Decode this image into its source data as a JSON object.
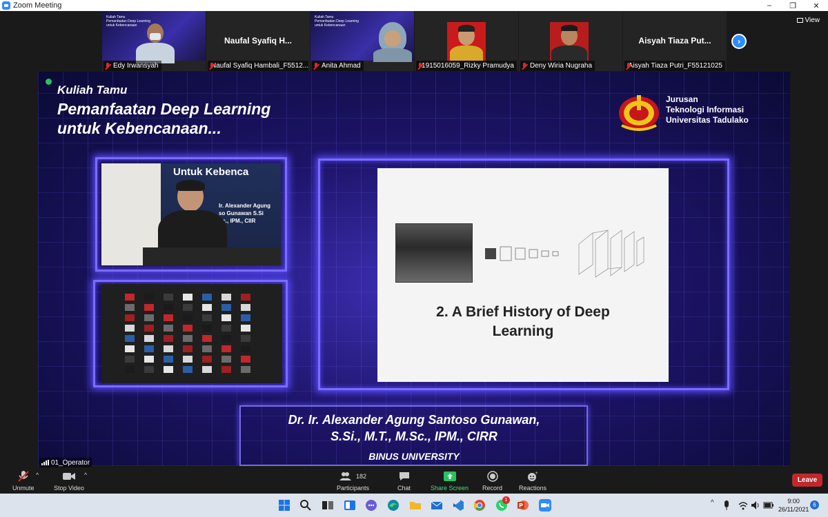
{
  "window": {
    "title": "Zoom Meeting"
  },
  "view": {
    "label": "View"
  },
  "participants_strip": [
    {
      "name": "Edy Irwansyah",
      "type": "video"
    },
    {
      "name": "Naufal Syafiq Hambali_F5512...",
      "center": "Naufal Syafiq H...",
      "type": "name"
    },
    {
      "name": "Anita Ahmad",
      "type": "video"
    },
    {
      "name": "1915016059_Rizky Pramudya",
      "type": "photo"
    },
    {
      "name": "Deny Wiria Nugraha",
      "type": "photo"
    },
    {
      "name": "Aisyah Tiaza Putri_F55121025",
      "center": "Aisyah Tiaza Put...",
      "type": "name"
    }
  ],
  "share": {
    "title1": "Kuliah Tamu",
    "title2": "Pemanfaatan Deep Learning",
    "title3": "untuk Kebencanaan...",
    "dept1": "Jurusan",
    "dept2": "Teknologi Informasi",
    "dept3": "Universitas Tadulako",
    "cam_banner": "Untuk Kebenca",
    "cam_lines": [
      "Ir. Alexander Agung",
      "so Gunawan S.Si",
      "Sc., IPM., CIIR"
    ],
    "slide_heading1": "2. A Brief History of Deep",
    "slide_heading2": "Learning",
    "speaker1": "Dr. Ir. Alexander Agung Santoso Gunawan,",
    "speaker2": "S.Si., M.T., M.Sc., IPM., CIRR",
    "speaker3": "BINUS UNIVERSITY",
    "operator": "01_Operator"
  },
  "toolbar": {
    "unmute": "Unmute",
    "stop_video": "Stop Video",
    "participants": "Participants",
    "participants_count": "182",
    "chat": "Chat",
    "share_screen": "Share Screen",
    "record": "Record",
    "reactions": "Reactions",
    "leave": "Leave"
  },
  "taskbar": {
    "time": "9:00",
    "date": "26/11/2021",
    "notifications": "6",
    "whatsapp_badge": "1"
  },
  "colors": {
    "zoom_blue": "#2d8cff",
    "leave_red": "#c0282b",
    "share_green": "#22c55e"
  }
}
